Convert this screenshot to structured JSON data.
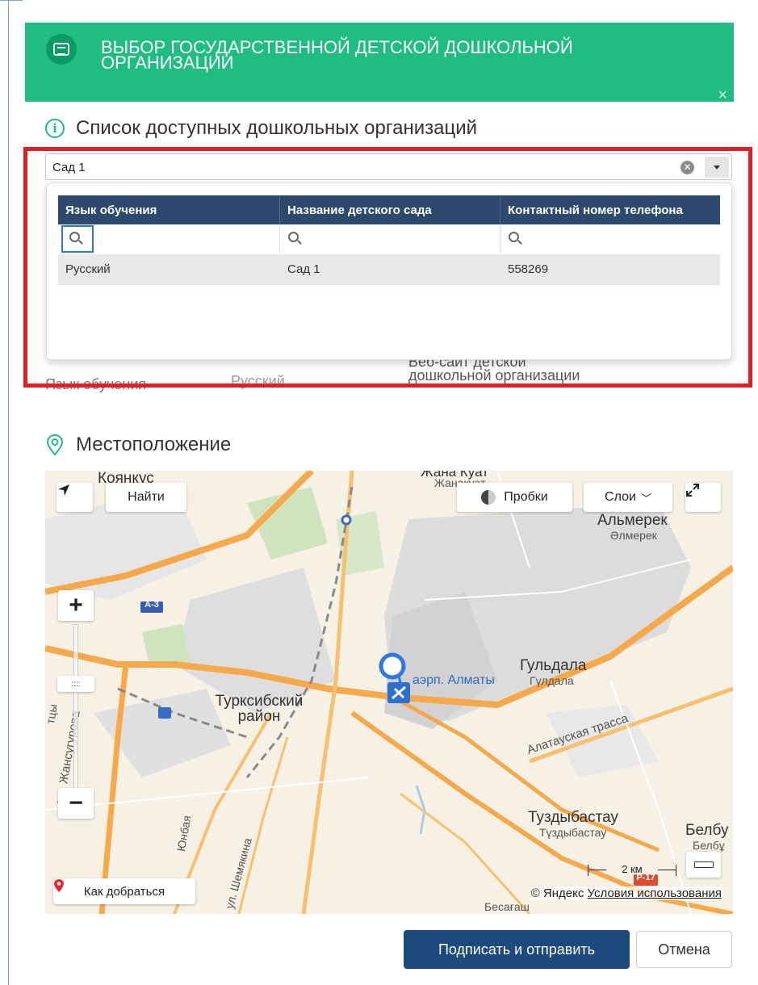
{
  "header": {
    "title": "ВЫБОР ГОСУДАРСТВЕННОЙ ДЕТСКОЙ ДОШКОЛЬНОЙ ОРГАНИЗАЦИИ",
    "close_label": "×",
    "icon": "kindergarten-icon"
  },
  "list_section": {
    "title": "Список доступных дошкольных организаций",
    "icon": "info-icon"
  },
  "select": {
    "value": "Сад 1"
  },
  "grid": {
    "columns": [
      "Язык обучения",
      "Название детского сада",
      "Контактный номер телефона"
    ],
    "rows": [
      [
        "Русский",
        "Сад 1",
        "558269"
      ]
    ]
  },
  "background_fields": {
    "language_label": "Язык обучения",
    "language_value": "Русский",
    "website_label": "Веб-сайт детской дошкольной организации"
  },
  "location_section": {
    "title": "Местоположение",
    "icon": "location-pin-icon"
  },
  "map": {
    "find_label": "Найти",
    "traffic_label": "Пробки",
    "layers_label": "Слои",
    "route_label": "Как добраться",
    "scale_label": "2 км",
    "copyright": "© Яндекс",
    "terms_label": "Условия использования",
    "road_badge_a3": "А-3",
    "road_badge_r17": "Р-17",
    "labels": {
      "koyankus": "Коянкус",
      "zhanakuat": "Жана Куат",
      "zhanakuat_kz": "Жанакуат",
      "almerek": "Альмерек",
      "almerek_kz": "Әлмерек",
      "gyldala": "Гульдала",
      "gyldala_kz": "Гүлдала",
      "airport": "аэрп. Алматы",
      "turksib": "Турксибский район",
      "alatau": "Алатауская трасса",
      "tuzdybastau": "Туздыбастау",
      "tuzdybastau_kz": "Түздыбастау",
      "belbu": "Белбу",
      "belbu_kz": "Белбұ",
      "besagash": "Бесағаш",
      "zhansugurova": "ул. Жансугурова",
      "shemyakina": "ул. Шемякина",
      "yunbaya": "Юнбая",
      "ytsy": "тцы"
    }
  },
  "actions": {
    "submit_label": "Подписать и отправить",
    "cancel_label": "Отмена"
  },
  "colors": {
    "header_bg": "#1fbd83",
    "grid_header_bg": "#2d4a6e",
    "highlight_border": "#e31e24",
    "primary_button": "#1d4a7d"
  }
}
